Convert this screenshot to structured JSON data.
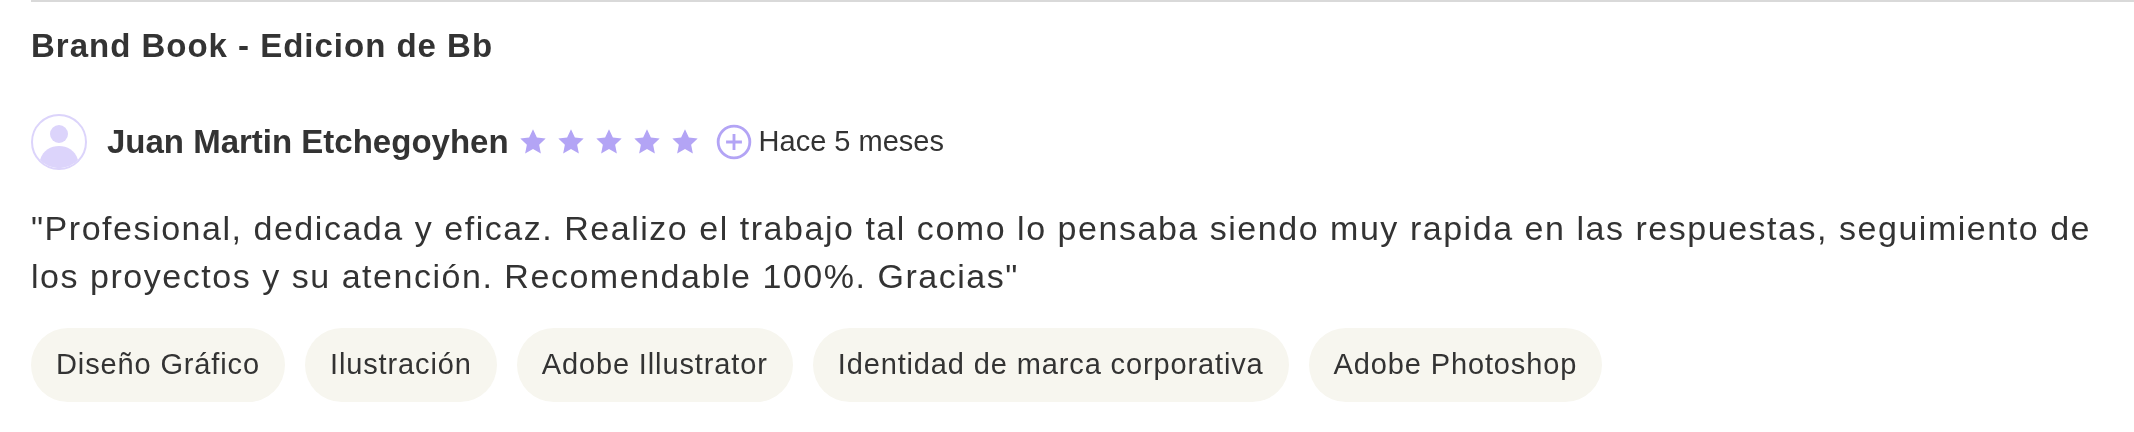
{
  "project_title": "Brand Book - Edicion de Bb",
  "review": {
    "reviewer": "Juan Martin Etchegoyhen",
    "stars": 5,
    "time": "Hace 5 meses",
    "text": "\"Profesional, dedicada y eficaz. Realizo el trabajo tal como lo pensaba siendo muy rapida en las respuestas, seguimiento de los proyectos y su atención. Recomendable 100%. Gracias\""
  },
  "tags": [
    "Diseño Gráfico",
    "Ilustración",
    "Adobe Illustrator",
    "Identidad de marca corporativa",
    "Adobe Photoshop"
  ]
}
